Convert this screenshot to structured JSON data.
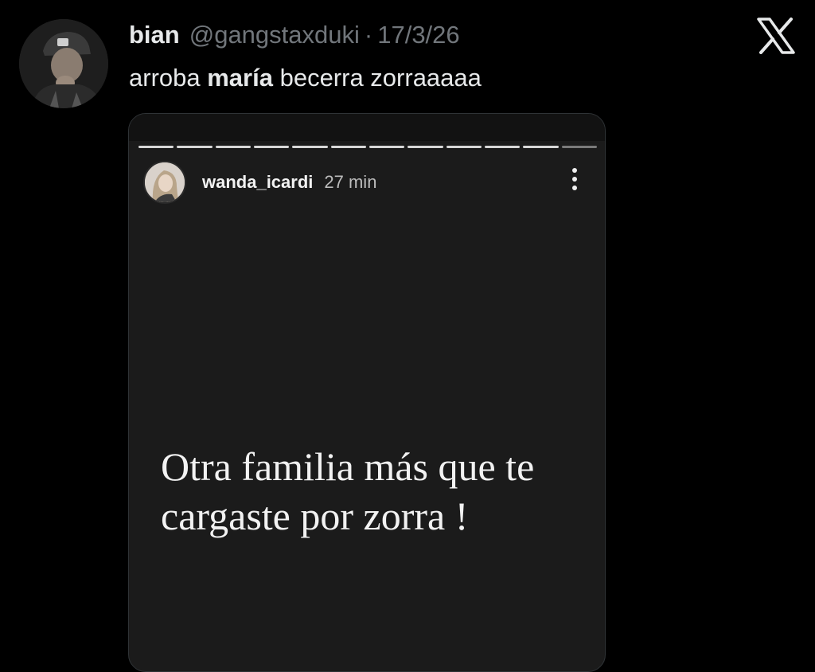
{
  "tweet": {
    "author_name": "bian",
    "handle": "@gangstaxduki",
    "separator": "·",
    "date": "17/3/26",
    "text_before": "arroba ",
    "text_bold": "maría",
    "text_after": " becerra zorraaaaa",
    "avatar_icon": "profile-photo"
  },
  "brand": {
    "logo_icon": "x-logo"
  },
  "story": {
    "username": "wanda_icardi",
    "time": "27 min",
    "caption_line1": "Otra familia más que te",
    "caption_line2": "cargaste por zorra !",
    "progress_segments": 12,
    "progress_active": 11,
    "more_icon": "more-vertical-icon"
  },
  "colors": {
    "background": "#000000",
    "primary_text": "#e7e9ea",
    "secondary_text": "#71767b",
    "story_background": "#1b1b1b"
  }
}
